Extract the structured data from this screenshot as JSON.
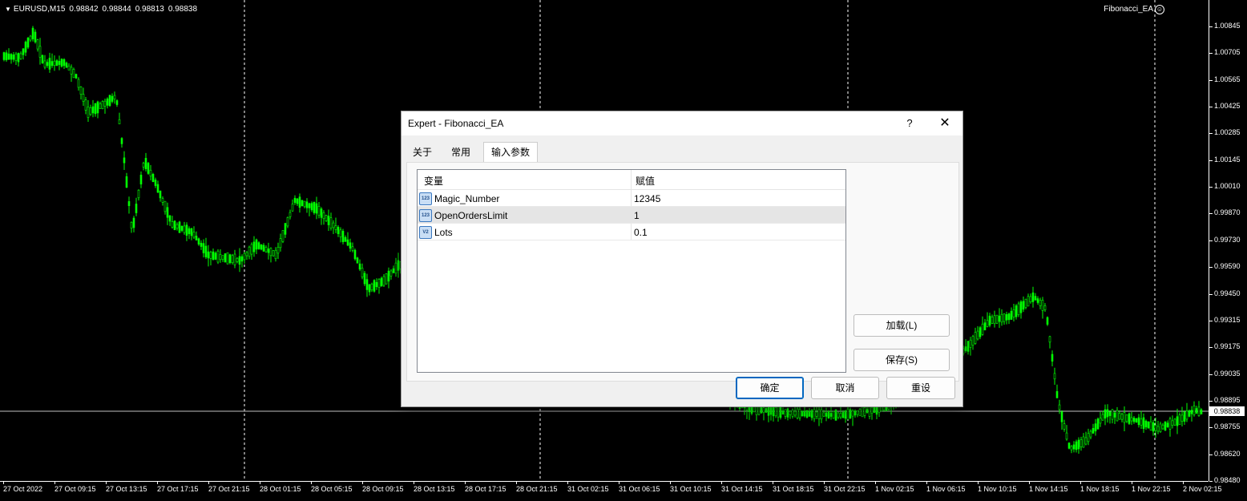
{
  "chart": {
    "symbol": "EURUSD,M15",
    "bid": "0.98842",
    "high": "0.98844",
    "low": "0.98813",
    "close": "0.98838",
    "expert_label": "Fibonacci_EA",
    "current_price": "0.98838",
    "price_ticks": [
      "1.00845",
      "1.00705",
      "1.00565",
      "1.00425",
      "1.00285",
      "1.00145",
      "1.00010",
      "0.99870",
      "0.99730",
      "0.99590",
      "0.99450",
      "0.99315",
      "0.99175",
      "0.99035",
      "0.98895",
      "0.98755",
      "0.98620",
      "0.98480"
    ],
    "time_ticks": [
      "27 Oct 2022",
      "27 Oct 09:15",
      "27 Oct 13:15",
      "27 Oct 17:15",
      "27 Oct 21:15",
      "28 Oct 01:15",
      "28 Oct 05:15",
      "28 Oct 09:15",
      "28 Oct 13:15",
      "28 Oct 17:15",
      "28 Oct 21:15",
      "31 Oct 02:15",
      "31 Oct 06:15",
      "31 Oct 10:15",
      "31 Oct 14:15",
      "31 Oct 18:15",
      "31 Oct 22:15",
      "1 Nov 02:15",
      "1 Nov 06:15",
      "1 Nov 10:15",
      "1 Nov 14:15",
      "1 Nov 18:15",
      "1 Nov 22:15",
      "2 Nov 02:15"
    ],
    "colors": {
      "background": "#000000",
      "candles": "#00ff00",
      "grid": "#ffffff",
      "axis": "#ffffff"
    }
  },
  "dialog": {
    "title": "Expert - Fibonacci_EA",
    "help": "?",
    "close": "✕",
    "tabs": [
      "关于",
      "常用",
      "输入参数"
    ],
    "active_tab": "输入参数",
    "table": {
      "headers": [
        "变量",
        "赋值"
      ],
      "rows": [
        {
          "icon": "123",
          "name": "Magic_Number",
          "value": "12345"
        },
        {
          "icon": "123",
          "name": "OpenOrdersLimit",
          "value": "1"
        },
        {
          "icon": "V2",
          "name": "Lots",
          "value": "0.1"
        }
      ]
    },
    "buttons": {
      "load": "加载(L)",
      "save": "保存(S)",
      "ok": "确定",
      "cancel": "取消",
      "reset": "重设"
    }
  }
}
